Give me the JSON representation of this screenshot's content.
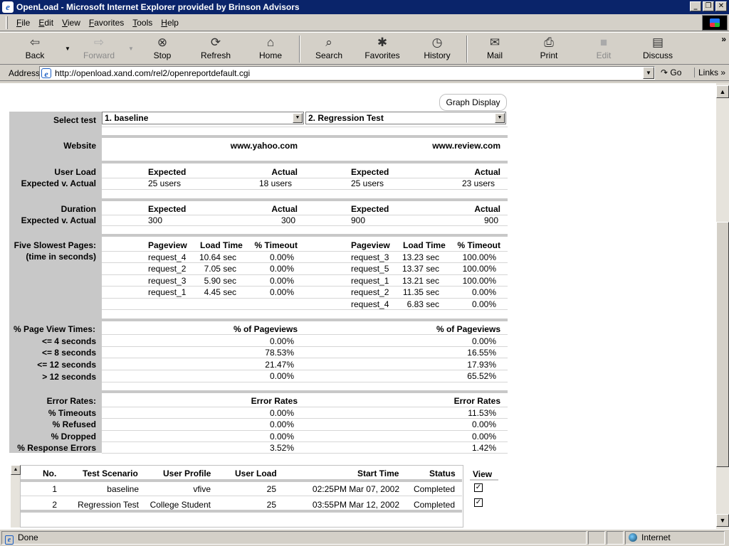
{
  "window": {
    "title": "OpenLoad - Microsoft Internet Explorer provided by Brinson Advisors"
  },
  "menu": [
    "File",
    "Edit",
    "View",
    "Favorites",
    "Tools",
    "Help"
  ],
  "toolbar": {
    "back": "Back",
    "forward": "Forward",
    "stop": "Stop",
    "refresh": "Refresh",
    "home": "Home",
    "search": "Search",
    "favorites": "Favorites",
    "history": "History",
    "mail": "Mail",
    "print": "Print",
    "edit": "Edit",
    "discuss": "Discuss"
  },
  "address": {
    "label": "Address",
    "url": "http://openload.xand.com/rel2/openreportdefault.cgi",
    "go": "Go",
    "links": "Links"
  },
  "report": {
    "graph_display": "Graph Display",
    "labels": {
      "select_test": "Select test",
      "website": "Website",
      "user_load": "User Load",
      "expected_actual": "Expected v. Actual",
      "duration": "Duration",
      "five_slowest": "Five Slowest Pages:",
      "time_in_seconds": "(time in seconds)",
      "page_view_times": "% Page View Times:",
      "le4": "<= 4 seconds",
      "le8": "<= 8 seconds",
      "le12": "<= 12 seconds",
      "gt12": "> 12 seconds",
      "error_rates": "Error Rates:",
      "timeouts": "% Timeouts",
      "refused": "% Refused",
      "dropped": "% Dropped",
      "response_errors": "% Response Errors"
    },
    "headers": {
      "expected": "Expected",
      "actual": "Actual",
      "pageview": "Pageview",
      "load_time": "Load Time",
      "timeout": "% Timeout",
      "pct_pageviews": "% of Pageviews",
      "error_rates": "Error Rates"
    },
    "test1": {
      "select": "1.   baseline",
      "website": "www.yahoo.com",
      "user_expected": "25 users",
      "user_actual": "18 users",
      "dur_expected": "300",
      "dur_actual": "300",
      "slowest": [
        {
          "page": "request_4",
          "load": "10.64 sec",
          "timeout": "0.00%"
        },
        {
          "page": "request_2",
          "load": "7.05 sec",
          "timeout": "0.00%"
        },
        {
          "page": "request_3",
          "load": "5.90 sec",
          "timeout": "0.00%"
        },
        {
          "page": "request_1",
          "load": "4.45 sec",
          "timeout": "0.00%"
        }
      ],
      "pv": [
        "0.00%",
        "78.53%",
        "21.47%",
        "0.00%"
      ],
      "err": [
        "0.00%",
        "0.00%",
        "0.00%",
        "3.52%"
      ]
    },
    "test2": {
      "select": "2.   Regression Test",
      "website": "www.review.com",
      "user_expected": "25 users",
      "user_actual": "23 users",
      "dur_expected": "900",
      "dur_actual": "900",
      "slowest": [
        {
          "page": "request_3",
          "load": "13.23 sec",
          "timeout": "100.00%"
        },
        {
          "page": "request_5",
          "load": "13.37 sec",
          "timeout": "100.00%"
        },
        {
          "page": "request_1",
          "load": "13.21 sec",
          "timeout": "100.00%"
        },
        {
          "page": "request_2",
          "load": "11.35 sec",
          "timeout": "0.00%"
        },
        {
          "page": "request_4",
          "load": "6.83 sec",
          "timeout": "0.00%"
        }
      ],
      "pv": [
        "0.00%",
        "16.55%",
        "17.93%",
        "65.52%"
      ],
      "err": [
        "11.53%",
        "0.00%",
        "0.00%",
        "1.42%"
      ]
    }
  },
  "tests_table": {
    "columns": [
      "No.",
      "Test Scenario",
      "User Profile",
      "User Load",
      "Start Time",
      "Status",
      "View"
    ],
    "rows": [
      {
        "no": "1",
        "scenario": "baseline",
        "profile": "vfive",
        "load": "25",
        "start": "02:25PM Mar 07, 2002",
        "status": "Completed"
      },
      {
        "no": "2",
        "scenario": "Regression Test",
        "profile": "College Student",
        "load": "25",
        "start": "03:55PM Mar 12, 2002",
        "status": "Completed"
      }
    ]
  },
  "status": {
    "text": "Done",
    "zone": "Internet"
  }
}
